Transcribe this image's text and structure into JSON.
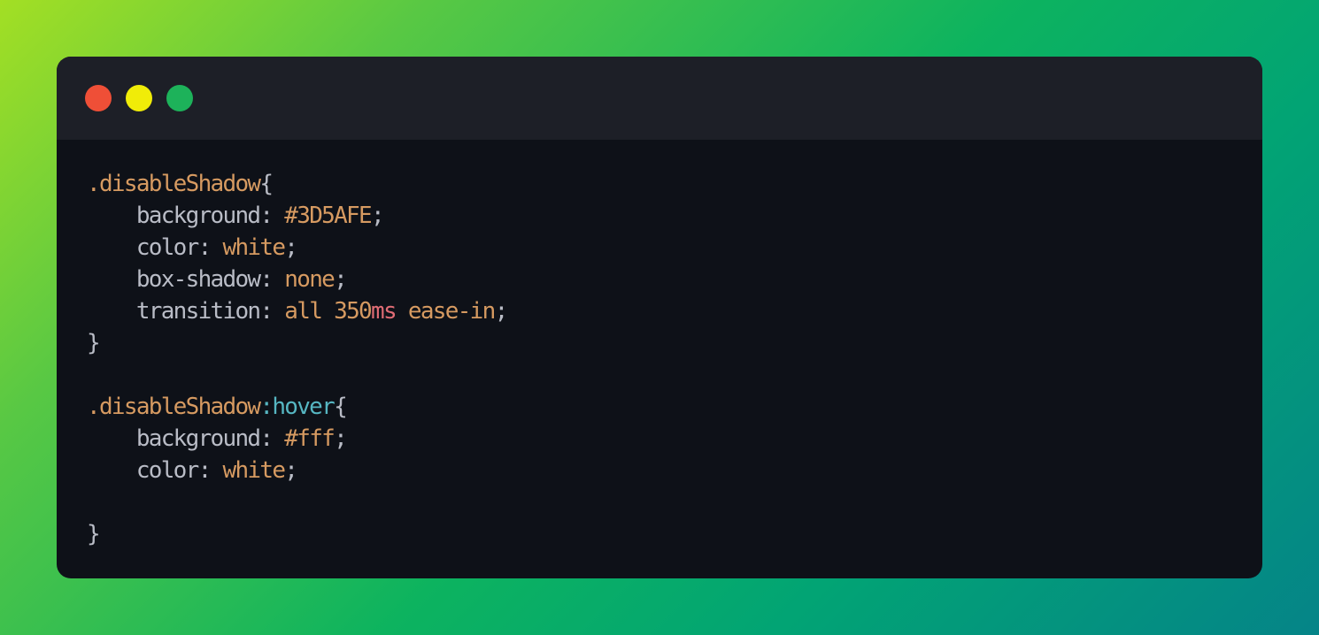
{
  "window_controls": {
    "close_color": "#ef4f37",
    "minimize_color": "#f0ec08",
    "maximize_color": "#1db25a"
  },
  "syntax_colors": {
    "selector": "#d69a61",
    "property": "#b9bcc6",
    "punctuation": "#b9bcc6",
    "value": "#d69a61",
    "unit": "#e06c75",
    "pseudo": "#56b6c2",
    "background": "#0e1118",
    "titlebar": "#1d1f27"
  },
  "code": {
    "lines": [
      [
        {
          "text": ".disableShadow",
          "kind": "selector"
        },
        {
          "text": "{",
          "kind": "punctuation"
        }
      ],
      [
        {
          "text": "    background",
          "kind": "property"
        },
        {
          "text": ": ",
          "kind": "punctuation"
        },
        {
          "text": "#3D5AFE",
          "kind": "value"
        },
        {
          "text": ";",
          "kind": "punctuation"
        }
      ],
      [
        {
          "text": "    color",
          "kind": "property"
        },
        {
          "text": ": ",
          "kind": "punctuation"
        },
        {
          "text": "white",
          "kind": "value"
        },
        {
          "text": ";",
          "kind": "punctuation"
        }
      ],
      [
        {
          "text": "    box-shadow",
          "kind": "property"
        },
        {
          "text": ": ",
          "kind": "punctuation"
        },
        {
          "text": "none",
          "kind": "value"
        },
        {
          "text": ";",
          "kind": "punctuation"
        }
      ],
      [
        {
          "text": "    transition",
          "kind": "property"
        },
        {
          "text": ": ",
          "kind": "punctuation"
        },
        {
          "text": "all",
          "kind": "value"
        },
        {
          "text": " ",
          "kind": "punctuation"
        },
        {
          "text": "350",
          "kind": "value"
        },
        {
          "text": "ms",
          "kind": "unit"
        },
        {
          "text": " ",
          "kind": "punctuation"
        },
        {
          "text": "ease-in",
          "kind": "value"
        },
        {
          "text": ";",
          "kind": "punctuation"
        }
      ],
      [
        {
          "text": "}",
          "kind": "punctuation"
        }
      ],
      [],
      [
        {
          "text": ".disableShadow",
          "kind": "selector"
        },
        {
          "text": ":hover",
          "kind": "pseudo"
        },
        {
          "text": "{",
          "kind": "punctuation"
        }
      ],
      [
        {
          "text": "    background",
          "kind": "property"
        },
        {
          "text": ": ",
          "kind": "punctuation"
        },
        {
          "text": "#fff",
          "kind": "value"
        },
        {
          "text": ";",
          "kind": "punctuation"
        }
      ],
      [
        {
          "text": "    color",
          "kind": "property"
        },
        {
          "text": ": ",
          "kind": "punctuation"
        },
        {
          "text": "white",
          "kind": "value"
        },
        {
          "text": ";",
          "kind": "punctuation"
        }
      ],
      [],
      [
        {
          "text": "}",
          "kind": "punctuation"
        }
      ]
    ]
  }
}
